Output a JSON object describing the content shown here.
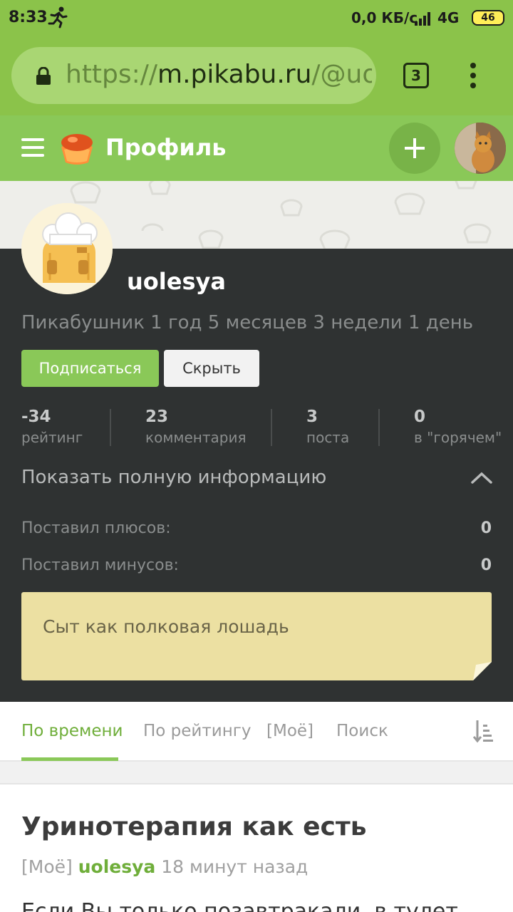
{
  "status_bar": {
    "time": "8:33",
    "speed": "0,0 КБ/с",
    "network": "4G",
    "battery": "46"
  },
  "browser": {
    "url_scheme": "https://",
    "url_host": "m.pikabu.ru",
    "url_path": "/@uolesya",
    "tab_count": "3"
  },
  "header": {
    "title": "Профиль",
    "icons": [
      "menu-icon",
      "pikabu-logo",
      "add-icon",
      "user-avatar"
    ]
  },
  "profile": {
    "username": "uolesya",
    "since": "Пикабушник 1 год 5 месяцев 3 недели 1 день",
    "subscribe_label": "Подписаться",
    "hide_label": "Скрыть",
    "stats": [
      {
        "value": "-34",
        "label": "рейтинг"
      },
      {
        "value": "23",
        "label": "комментария"
      },
      {
        "value": "3",
        "label": "поста"
      },
      {
        "value": "0",
        "label": "в \"горячем\""
      }
    ],
    "full_info_label": "Показать полную информацию",
    "pluses_label": "Поставил плюсов:",
    "pluses_value": "0",
    "minuses_label": "Поставил минусов:",
    "minuses_value": "0",
    "note": "Сыт как полковая лошадь"
  },
  "tabs": [
    {
      "label": "По времени",
      "active": true
    },
    {
      "label": "По рейтингу",
      "active": false
    },
    {
      "label": "[Моё]",
      "active": false
    },
    {
      "label": "Поиск",
      "active": false
    }
  ],
  "post": {
    "title": "Уринотерапия как есть",
    "tag": "[Моё]",
    "author": "uolesya",
    "time_ago": "18 минут назад",
    "excerpt": "Если Вы только позавтракали, в тулет"
  },
  "colors": {
    "brand_green": "#8ac858",
    "profile_bg": "#2f3232",
    "note_bg": "#ece0a2"
  }
}
